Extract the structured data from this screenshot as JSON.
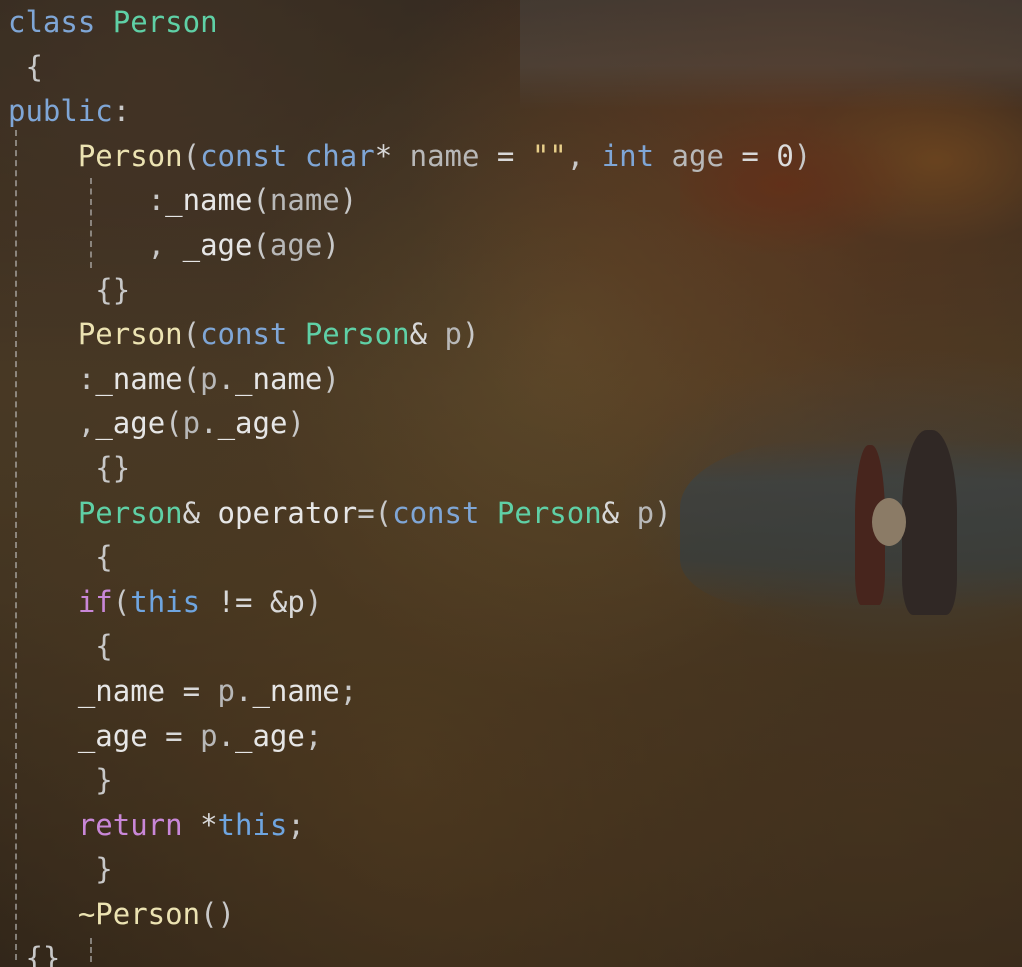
{
  "editor": {
    "lines": [
      [
        {
          "t": "class ",
          "c": "kw"
        },
        {
          "t": "Person",
          "c": "type"
        }
      ],
      [
        {
          "t": " {",
          "c": "punc"
        }
      ],
      [
        {
          "t": "public",
          "c": "kw"
        },
        {
          "t": ":",
          "c": "punc"
        }
      ],
      [
        {
          "t": "    Person",
          "c": "fn"
        },
        {
          "t": "(",
          "c": "punc"
        },
        {
          "t": "const ",
          "c": "kw"
        },
        {
          "t": "char",
          "c": "kw"
        },
        {
          "t": "* ",
          "c": "op"
        },
        {
          "t": "name",
          "c": "param"
        },
        {
          "t": " = ",
          "c": "op"
        },
        {
          "t": "\"\"",
          "c": "str"
        },
        {
          "t": ", ",
          "c": "punc"
        },
        {
          "t": "int ",
          "c": "kw"
        },
        {
          "t": "age",
          "c": "param"
        },
        {
          "t": " = ",
          "c": "op"
        },
        {
          "t": "0",
          "c": "num"
        },
        {
          "t": ")",
          "c": "punc"
        }
      ],
      [
        {
          "t": "        :",
          "c": "punc"
        },
        {
          "t": "_name",
          "c": "member"
        },
        {
          "t": "(",
          "c": "punc"
        },
        {
          "t": "name",
          "c": "param"
        },
        {
          "t": ")",
          "c": "punc"
        }
      ],
      [
        {
          "t": "        , ",
          "c": "punc"
        },
        {
          "t": "_age",
          "c": "member"
        },
        {
          "t": "(",
          "c": "punc"
        },
        {
          "t": "age",
          "c": "param"
        },
        {
          "t": ")",
          "c": "punc"
        }
      ],
      [
        {
          "t": "     {}",
          "c": "punc"
        }
      ],
      [
        {
          "t": "    Person",
          "c": "fn"
        },
        {
          "t": "(",
          "c": "punc"
        },
        {
          "t": "const ",
          "c": "kw"
        },
        {
          "t": "Person",
          "c": "type"
        },
        {
          "t": "& ",
          "c": "op"
        },
        {
          "t": "p",
          "c": "param"
        },
        {
          "t": ")",
          "c": "punc"
        }
      ],
      [
        {
          "t": "    :",
          "c": "punc"
        },
        {
          "t": "_name",
          "c": "member"
        },
        {
          "t": "(",
          "c": "punc"
        },
        {
          "t": "p",
          "c": "param"
        },
        {
          "t": ".",
          "c": "punc"
        },
        {
          "t": "_name",
          "c": "member"
        },
        {
          "t": ")",
          "c": "punc"
        }
      ],
      [
        {
          "t": "    ,",
          "c": "punc"
        },
        {
          "t": "_age",
          "c": "member"
        },
        {
          "t": "(",
          "c": "punc"
        },
        {
          "t": "p",
          "c": "param"
        },
        {
          "t": ".",
          "c": "punc"
        },
        {
          "t": "_age",
          "c": "member"
        },
        {
          "t": ")",
          "c": "punc"
        }
      ],
      [
        {
          "t": "     {}",
          "c": "punc"
        }
      ],
      [
        {
          "t": "    Person",
          "c": "type"
        },
        {
          "t": "& ",
          "c": "op"
        },
        {
          "t": "operator",
          "c": "member"
        },
        {
          "t": "=(",
          "c": "punc"
        },
        {
          "t": "const ",
          "c": "kw"
        },
        {
          "t": "Person",
          "c": "type"
        },
        {
          "t": "& ",
          "c": "op"
        },
        {
          "t": "p",
          "c": "param"
        },
        {
          "t": ")",
          "c": "punc"
        }
      ],
      [
        {
          "t": "     {",
          "c": "punc"
        }
      ],
      [
        {
          "t": "    if",
          "c": "ctrl"
        },
        {
          "t": "(",
          "c": "punc"
        },
        {
          "t": "this",
          "c": "kw2"
        },
        {
          "t": " != ",
          "c": "op"
        },
        {
          "t": "&p",
          "c": "op"
        },
        {
          "t": ")",
          "c": "punc"
        }
      ],
      [
        {
          "t": "     {",
          "c": "punc"
        }
      ],
      [
        {
          "t": "    _name",
          "c": "member"
        },
        {
          "t": " = ",
          "c": "op"
        },
        {
          "t": "p",
          "c": "param"
        },
        {
          "t": ".",
          "c": "punc"
        },
        {
          "t": "_name",
          "c": "member"
        },
        {
          "t": ";",
          "c": "punc"
        }
      ],
      [
        {
          "t": "    _age",
          "c": "member"
        },
        {
          "t": " = ",
          "c": "op"
        },
        {
          "t": "p",
          "c": "param"
        },
        {
          "t": ".",
          "c": "punc"
        },
        {
          "t": "_age",
          "c": "member"
        },
        {
          "t": ";",
          "c": "punc"
        }
      ],
      [
        {
          "t": "     }",
          "c": "punc"
        }
      ],
      [
        {
          "t": "    return ",
          "c": "ctrl"
        },
        {
          "t": "*",
          "c": "op"
        },
        {
          "t": "this",
          "c": "kw2"
        },
        {
          "t": ";",
          "c": "punc"
        }
      ],
      [
        {
          "t": "     }",
          "c": "punc"
        }
      ],
      [
        {
          "t": "    ~Person",
          "c": "fn"
        },
        {
          "t": "()",
          "c": "punc"
        }
      ],
      [
        {
          "t": " {}",
          "c": "punc"
        }
      ]
    ]
  },
  "colors": {
    "keyword": "#7fa6d6",
    "type": "#5fd0a6",
    "function": "#ece3b2",
    "control": "#c987d8",
    "parameter": "#b8b8b8"
  }
}
